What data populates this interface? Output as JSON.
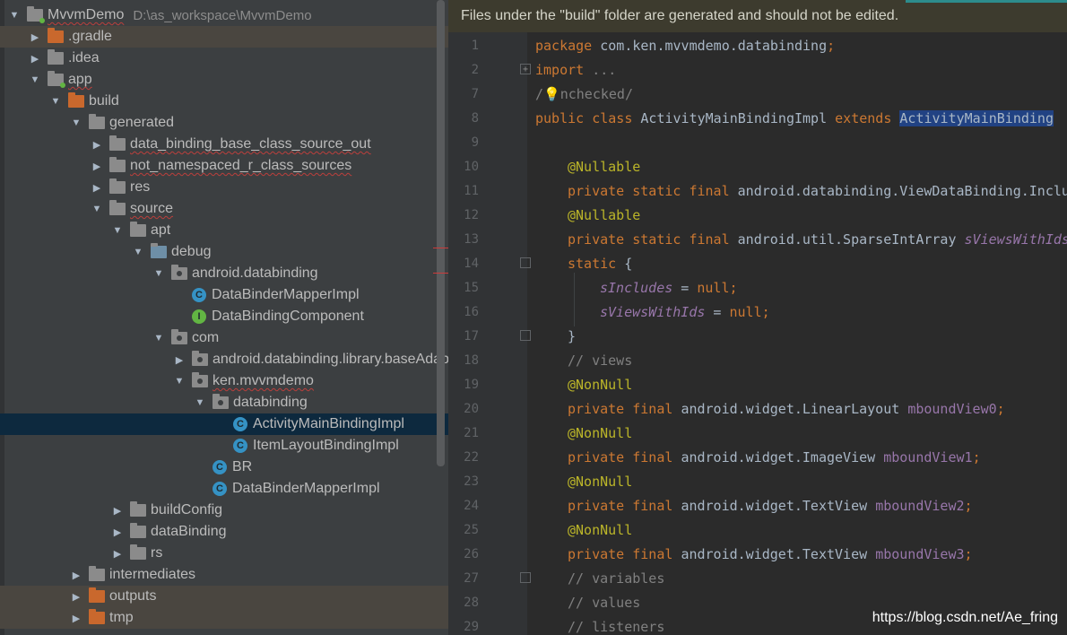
{
  "tree": {
    "rows": [
      {
        "label": "MvvmDemo",
        "sub": "D:\\as_workspace\\MvvmDemo",
        "icon": "module-folder",
        "arrow": "open",
        "indent": 0,
        "wavy": true
      },
      {
        "label": ".gradle",
        "icon": "folder-orange",
        "arrow": "closed",
        "indent": 1,
        "hl": true
      },
      {
        "label": ".idea",
        "icon": "folder",
        "arrow": "closed",
        "indent": 1
      },
      {
        "label": "app",
        "icon": "module-folder",
        "arrow": "open",
        "indent": 1,
        "wavy": true
      },
      {
        "label": "build",
        "icon": "folder-orange",
        "arrow": "open",
        "indent": 2
      },
      {
        "label": "generated",
        "icon": "folder",
        "arrow": "open",
        "indent": 3
      },
      {
        "label": "data_binding_base_class_source_out",
        "icon": "folder",
        "arrow": "closed",
        "indent": 4,
        "wavy": true
      },
      {
        "label": "not_namespaced_r_class_sources",
        "icon": "folder",
        "arrow": "closed",
        "indent": 4,
        "wavy": true
      },
      {
        "label": "res",
        "icon": "folder",
        "arrow": "closed",
        "indent": 4
      },
      {
        "label": "source",
        "icon": "folder",
        "arrow": "open",
        "indent": 4,
        "wavy": true
      },
      {
        "label": "apt",
        "icon": "folder",
        "arrow": "open",
        "indent": 5
      },
      {
        "label": "debug",
        "icon": "folder-gen",
        "arrow": "open",
        "indent": 6
      },
      {
        "label": "android.databinding",
        "icon": "package",
        "arrow": "open",
        "indent": 7
      },
      {
        "label": "DataBinderMapperImpl",
        "icon": "class-c",
        "arrow": "none",
        "indent": 8
      },
      {
        "label": "DataBindingComponent",
        "icon": "class-i",
        "arrow": "none",
        "indent": 8
      },
      {
        "label": "com",
        "icon": "package",
        "arrow": "open",
        "indent": 7
      },
      {
        "label": "android.databinding.library.baseAdapters",
        "icon": "package",
        "arrow": "closed",
        "indent": 8
      },
      {
        "label": "ken.mvvmdemo",
        "icon": "package",
        "arrow": "open",
        "indent": 8,
        "wavy": true
      },
      {
        "label": "databinding",
        "icon": "package",
        "arrow": "open",
        "indent": 9
      },
      {
        "label": "ActivityMainBindingImpl",
        "icon": "class-c",
        "arrow": "none",
        "indent": 10,
        "selected": true
      },
      {
        "label": "ItemLayoutBindingImpl",
        "icon": "class-c",
        "arrow": "none",
        "indent": 10
      },
      {
        "label": "BR",
        "icon": "class-c",
        "arrow": "none",
        "indent": 9
      },
      {
        "label": "DataBinderMapperImpl",
        "icon": "class-c",
        "arrow": "none",
        "indent": 9
      },
      {
        "label": "buildConfig",
        "icon": "folder",
        "arrow": "closed",
        "indent": 5
      },
      {
        "label": "dataBinding",
        "icon": "folder",
        "arrow": "closed",
        "indent": 5
      },
      {
        "label": "rs",
        "icon": "folder",
        "arrow": "closed",
        "indent": 5
      },
      {
        "label": "intermediates",
        "icon": "folder",
        "arrow": "closed",
        "indent": 3
      },
      {
        "label": "outputs",
        "icon": "folder-orange",
        "arrow": "closed",
        "indent": 3,
        "hl": true
      },
      {
        "label": "tmp",
        "icon": "folder-orange",
        "arrow": "closed",
        "indent": 3,
        "hl": true
      }
    ]
  },
  "editor": {
    "banner": "Files under the \"build\" folder are generated and should not be edited.",
    "lines": [
      {
        "n": "1",
        "segs": [
          [
            "kw",
            "package "
          ],
          [
            "",
            "com.ken.mvvmdemo.databinding"
          ],
          [
            "kw",
            ";"
          ]
        ]
      },
      {
        "n": "2",
        "fold": "+",
        "segs": [
          [
            "kw",
            "import "
          ],
          [
            "cm",
            "..."
          ]
        ]
      },
      {
        "n": "7",
        "segs": [
          [
            "cm",
            "/"
          ],
          [
            "bulb",
            "💡"
          ],
          [
            "cm",
            "nchecked/"
          ]
        ]
      },
      {
        "n": "8",
        "segs": [
          [
            "kw",
            "public class "
          ],
          [
            "",
            "ActivityMainBindingImpl "
          ],
          [
            "kw",
            "extends "
          ],
          [
            "sel",
            "ActivityMainBinding"
          ]
        ]
      },
      {
        "n": "9",
        "segs": []
      },
      {
        "n": "10",
        "indent": 1,
        "segs": [
          [
            "ann",
            "@Nullable"
          ]
        ]
      },
      {
        "n": "11",
        "indent": 1,
        "segs": [
          [
            "kw",
            "private static final "
          ],
          [
            "",
            "android.databinding.ViewDataBinding.IncludedLayouts "
          ]
        ]
      },
      {
        "n": "12",
        "indent": 1,
        "segs": [
          [
            "ann",
            "@Nullable"
          ]
        ]
      },
      {
        "n": "13",
        "indent": 1,
        "segs": [
          [
            "kw",
            "private static final "
          ],
          [
            "",
            "android.util.SparseIntArray "
          ],
          [
            "it",
            "sViewsWithIds"
          ]
        ]
      },
      {
        "n": "14",
        "indent": 1,
        "fold": "-",
        "segs": [
          [
            "kw",
            "static "
          ],
          [
            "",
            "{"
          ]
        ]
      },
      {
        "n": "15",
        "indent": 2,
        "segs": [
          [
            "it",
            "sIncludes"
          ],
          [
            "",
            " = "
          ],
          [
            "kw",
            "null;"
          ]
        ]
      },
      {
        "n": "16",
        "indent": 2,
        "segs": [
          [
            "it",
            "sViewsWithIds"
          ],
          [
            "",
            " = "
          ],
          [
            "kw",
            "null;"
          ]
        ]
      },
      {
        "n": "17",
        "indent": 1,
        "fold": "-",
        "segs": [
          [
            "",
            "}"
          ]
        ]
      },
      {
        "n": "18",
        "indent": 1,
        "segs": [
          [
            "cm",
            "// views"
          ]
        ]
      },
      {
        "n": "19",
        "indent": 1,
        "segs": [
          [
            "ann",
            "@NonNull"
          ]
        ]
      },
      {
        "n": "20",
        "indent": 1,
        "segs": [
          [
            "kw",
            "private final "
          ],
          [
            "",
            "android.widget.LinearLayout "
          ],
          [
            "fld",
            "mboundView0"
          ],
          [
            "kw",
            ";"
          ]
        ]
      },
      {
        "n": "21",
        "indent": 1,
        "segs": [
          [
            "ann",
            "@NonNull"
          ]
        ]
      },
      {
        "n": "22",
        "indent": 1,
        "segs": [
          [
            "kw",
            "private final "
          ],
          [
            "",
            "android.widget.ImageView "
          ],
          [
            "fld",
            "mboundView1"
          ],
          [
            "kw",
            ";"
          ]
        ]
      },
      {
        "n": "23",
        "indent": 1,
        "segs": [
          [
            "ann",
            "@NonNull"
          ]
        ]
      },
      {
        "n": "24",
        "indent": 1,
        "segs": [
          [
            "kw",
            "private final "
          ],
          [
            "",
            "android.widget.TextView "
          ],
          [
            "fld",
            "mboundView2"
          ],
          [
            "kw",
            ";"
          ]
        ]
      },
      {
        "n": "25",
        "indent": 1,
        "segs": [
          [
            "ann",
            "@NonNull"
          ]
        ]
      },
      {
        "n": "26",
        "indent": 1,
        "segs": [
          [
            "kw",
            "private final "
          ],
          [
            "",
            "android.widget.TextView "
          ],
          [
            "fld",
            "mboundView3"
          ],
          [
            "kw",
            ";"
          ]
        ]
      },
      {
        "n": "27",
        "indent": 1,
        "fold": "-",
        "segs": [
          [
            "cm",
            "// variables"
          ]
        ]
      },
      {
        "n": "28",
        "indent": 1,
        "segs": [
          [
            "cm",
            "// values"
          ]
        ]
      },
      {
        "n": "29",
        "indent": 1,
        "segs": [
          [
            "cm",
            "// listeners"
          ]
        ]
      }
    ]
  },
  "watermark": "https://blog.csdn.net/Ae_fring",
  "colors": {
    "keyword": "#cc7832",
    "annotation": "#bbb529",
    "comment": "#808080",
    "field": "#9876aa",
    "selection": "#214283"
  }
}
